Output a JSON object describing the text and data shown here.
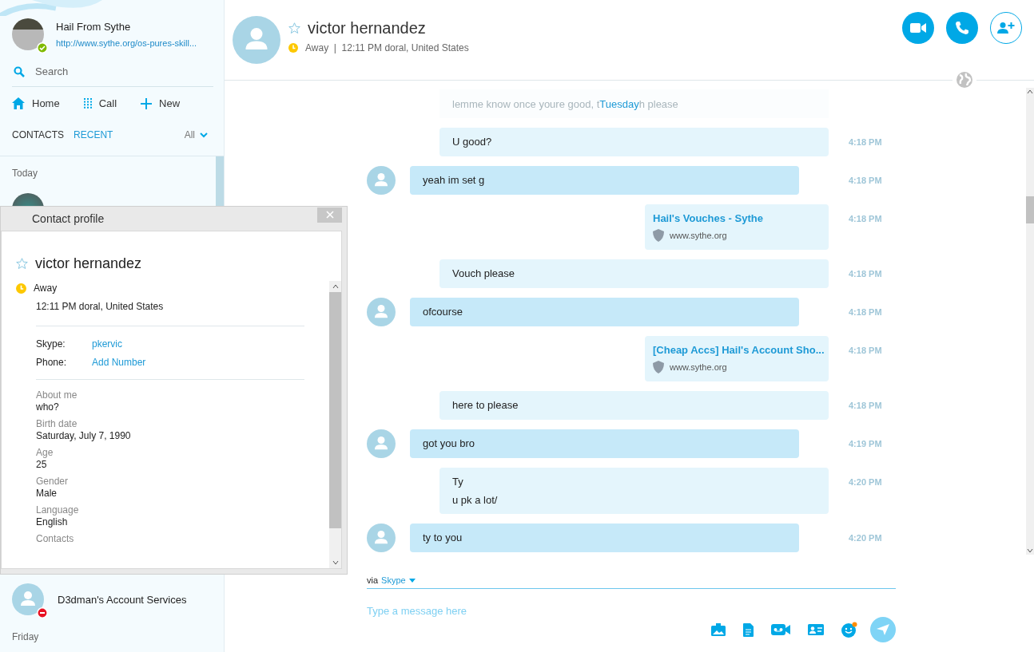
{
  "profile": {
    "name": "Hail From Sythe",
    "mood_link": "http://www.sythe.org/os-pures-skill...",
    "color": "#7fba00"
  },
  "search": {
    "placeholder": "Search"
  },
  "nav": [
    {
      "kind": "home",
      "label": "Home"
    },
    {
      "kind": "dialpad",
      "label": "Call"
    },
    {
      "kind": "plus",
      "label": "New"
    }
  ],
  "list_tabs": [
    {
      "label": "CONTACTS",
      "selected": false
    },
    {
      "label": "RECENT",
      "selected": true
    }
  ],
  "filter": {
    "label": "All"
  },
  "recent": [
    {
      "label": "Today",
      "contacts": [
        {
          "photo": true
        },
        {
          "name": "D3dman's Account Services",
          "photo": false,
          "color": "#e81123"
        }
      ]
    },
    {
      "label": "Friday"
    }
  ],
  "contact_profile": {
    "title": "Contact profile",
    "name": "victor hernandez",
    "favorite": false,
    "status": {
      "label": "Away",
      "color": "#fdc800"
    },
    "local_time": "12:11 PM doral, United States",
    "accounts": [
      {
        "label": "Skype:",
        "value": "pkervic"
      },
      {
        "label": "Phone:",
        "value": "Add Number"
      }
    ],
    "fields": [
      {
        "label": "About me",
        "value": "who?"
      },
      {
        "label": "Birth date",
        "value": "Saturday, July 7, 1990"
      },
      {
        "label": "Age",
        "value": "25"
      },
      {
        "label": "Gender",
        "value": "Male"
      },
      {
        "label": "Language",
        "value": "English"
      },
      {
        "label": "Contacts"
      }
    ]
  },
  "chat_header": {
    "name": "victor hernandez",
    "favorite": false,
    "status": {
      "color": "#fdc800"
    },
    "status_line": "Away  |  12:11 PM doral, United States"
  },
  "messages": [
    {
      "kind": "date",
      "label": "Tuesday",
      "faded_before": "lemme know once youre good, t",
      "faded_after": "h please"
    },
    {
      "kind": "text",
      "incoming": false,
      "lines": [
        "U good?"
      ],
      "time": "4:18 PM"
    },
    {
      "kind": "text",
      "incoming": true,
      "lines": [
        "yeah im set g"
      ],
      "time": "4:18 PM"
    },
    {
      "kind": "link",
      "incoming": false,
      "title": "Hail's Vouches - Sythe",
      "site": "www.sythe.org",
      "time": "4:18 PM"
    },
    {
      "kind": "text",
      "incoming": false,
      "lines": [
        "Vouch please"
      ],
      "time": "4:18 PM"
    },
    {
      "kind": "text",
      "incoming": true,
      "lines": [
        "ofcourse"
      ],
      "time": "4:18 PM"
    },
    {
      "kind": "link",
      "incoming": false,
      "title": "[Cheap Accs] Hail's Account Sho...",
      "site": "www.sythe.org",
      "time": "4:18 PM"
    },
    {
      "kind": "text",
      "incoming": false,
      "lines": [
        "here to please"
      ],
      "time": "4:18 PM"
    },
    {
      "kind": "text",
      "incoming": true,
      "lines": [
        "got you bro"
      ],
      "time": "4:19 PM"
    },
    {
      "kind": "text",
      "incoming": false,
      "lines": [
        "Ty",
        "u pk a lot/"
      ],
      "time": "4:20 PM"
    },
    {
      "kind": "text",
      "incoming": true,
      "lines": [
        "ty to you"
      ],
      "time": "4:20 PM"
    }
  ],
  "composer": {
    "via": "via",
    "service": "Skype",
    "placeholder": "Type a message here"
  }
}
